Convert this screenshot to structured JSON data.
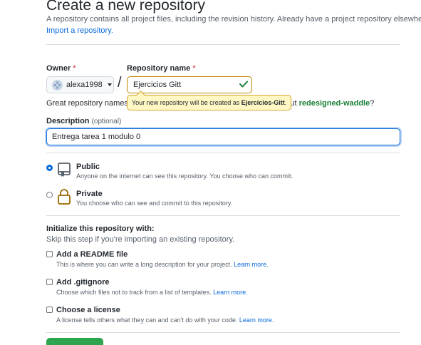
{
  "page": {
    "title": "Create a new repository",
    "intro": "A repository contains all project files, including the revision history. Already have a project repository elsewhere?",
    "import_link": "Import a repository."
  },
  "owner": {
    "label": "Owner",
    "required_mark": "*",
    "value": "alexa1998"
  },
  "separator": "/",
  "repo_name": {
    "label": "Repository name",
    "required_mark": "*",
    "value": "Ejercicios Gitt"
  },
  "hint": {
    "prefix": "Great repository names ar",
    "about_prefix": "about ",
    "suggestion": "redesigned-waddle",
    "suffix": "?"
  },
  "tooltip": {
    "prefix": "Your new repository will be created as ",
    "name": "Ejercicios-Gitt",
    "suffix": "."
  },
  "description": {
    "label": "Description",
    "optional": "(optional)",
    "value": "Entrega tarea 1 modulo 0"
  },
  "visibility": {
    "public": {
      "title": "Public",
      "desc": "Anyone on the internet can see this repository. You choose who can commit.",
      "selected": true
    },
    "private": {
      "title": "Private",
      "desc": "You choose who can see and commit to this repository.",
      "selected": false
    }
  },
  "init": {
    "heading": "Initialize this repository with:",
    "skip": "Skip this step if you're importing an existing repository.",
    "readme": {
      "title": "Add a README file",
      "desc": "This is where you can write a long description for your project.",
      "link": "Learn more."
    },
    "gitignore": {
      "title": "Add .gitignore",
      "desc": "Choose which files not to track from a list of templates.",
      "link": "Learn more."
    },
    "license": {
      "title": "Choose a license",
      "desc": "A license tells others what they can and can't do with your code.",
      "link": "Learn more."
    }
  },
  "colors": {
    "accent": "#0969da",
    "success": "#1a7f37",
    "danger": "#cf222e",
    "warning_border": "#bf8700",
    "tooltip_bg": "#fff8c5"
  }
}
